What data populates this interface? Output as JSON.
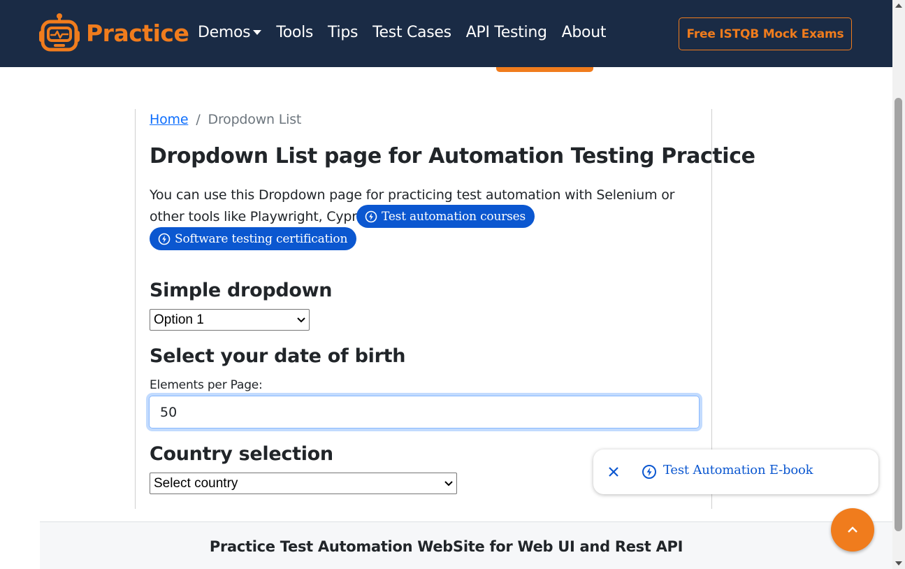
{
  "navbar": {
    "brand": "Practice",
    "links": [
      {
        "label": "Demos",
        "dropdown": true
      },
      {
        "label": "Tools"
      },
      {
        "label": "Tips"
      },
      {
        "label": "Test Cases"
      },
      {
        "label": "API Testing"
      },
      {
        "label": "About"
      }
    ],
    "cta": "Free ISTQB Mock Exams"
  },
  "breadcrumb": {
    "home": "Home",
    "separator": "/",
    "current": "Dropdown List"
  },
  "page": {
    "title": "Dropdown List page for Automation Testing Practice",
    "intro": "You can use this Dropdown page for practicing test automation with Selenium or other tools like Playwright, Cypress, etc.",
    "pill_courses": "Test automation courses",
    "pill_certification": "Software testing certification"
  },
  "simple_dropdown": {
    "heading": "Simple dropdown",
    "selected": "Option 1"
  },
  "dob": {
    "heading": "Select your date of birth",
    "label": "Elements per Page:",
    "value": "50"
  },
  "country": {
    "heading": "Country selection",
    "selected": "Select country"
  },
  "popup": {
    "text": "Test Automation E-book"
  },
  "footer": {
    "text": "Practice Test Automation WebSite for Web UI and Rest API"
  },
  "colors": {
    "navbar_bg": "#1a2b45",
    "accent_orange": "#f07c1d",
    "link_blue": "#0d6efd",
    "pill_blue": "#0b57d0"
  }
}
